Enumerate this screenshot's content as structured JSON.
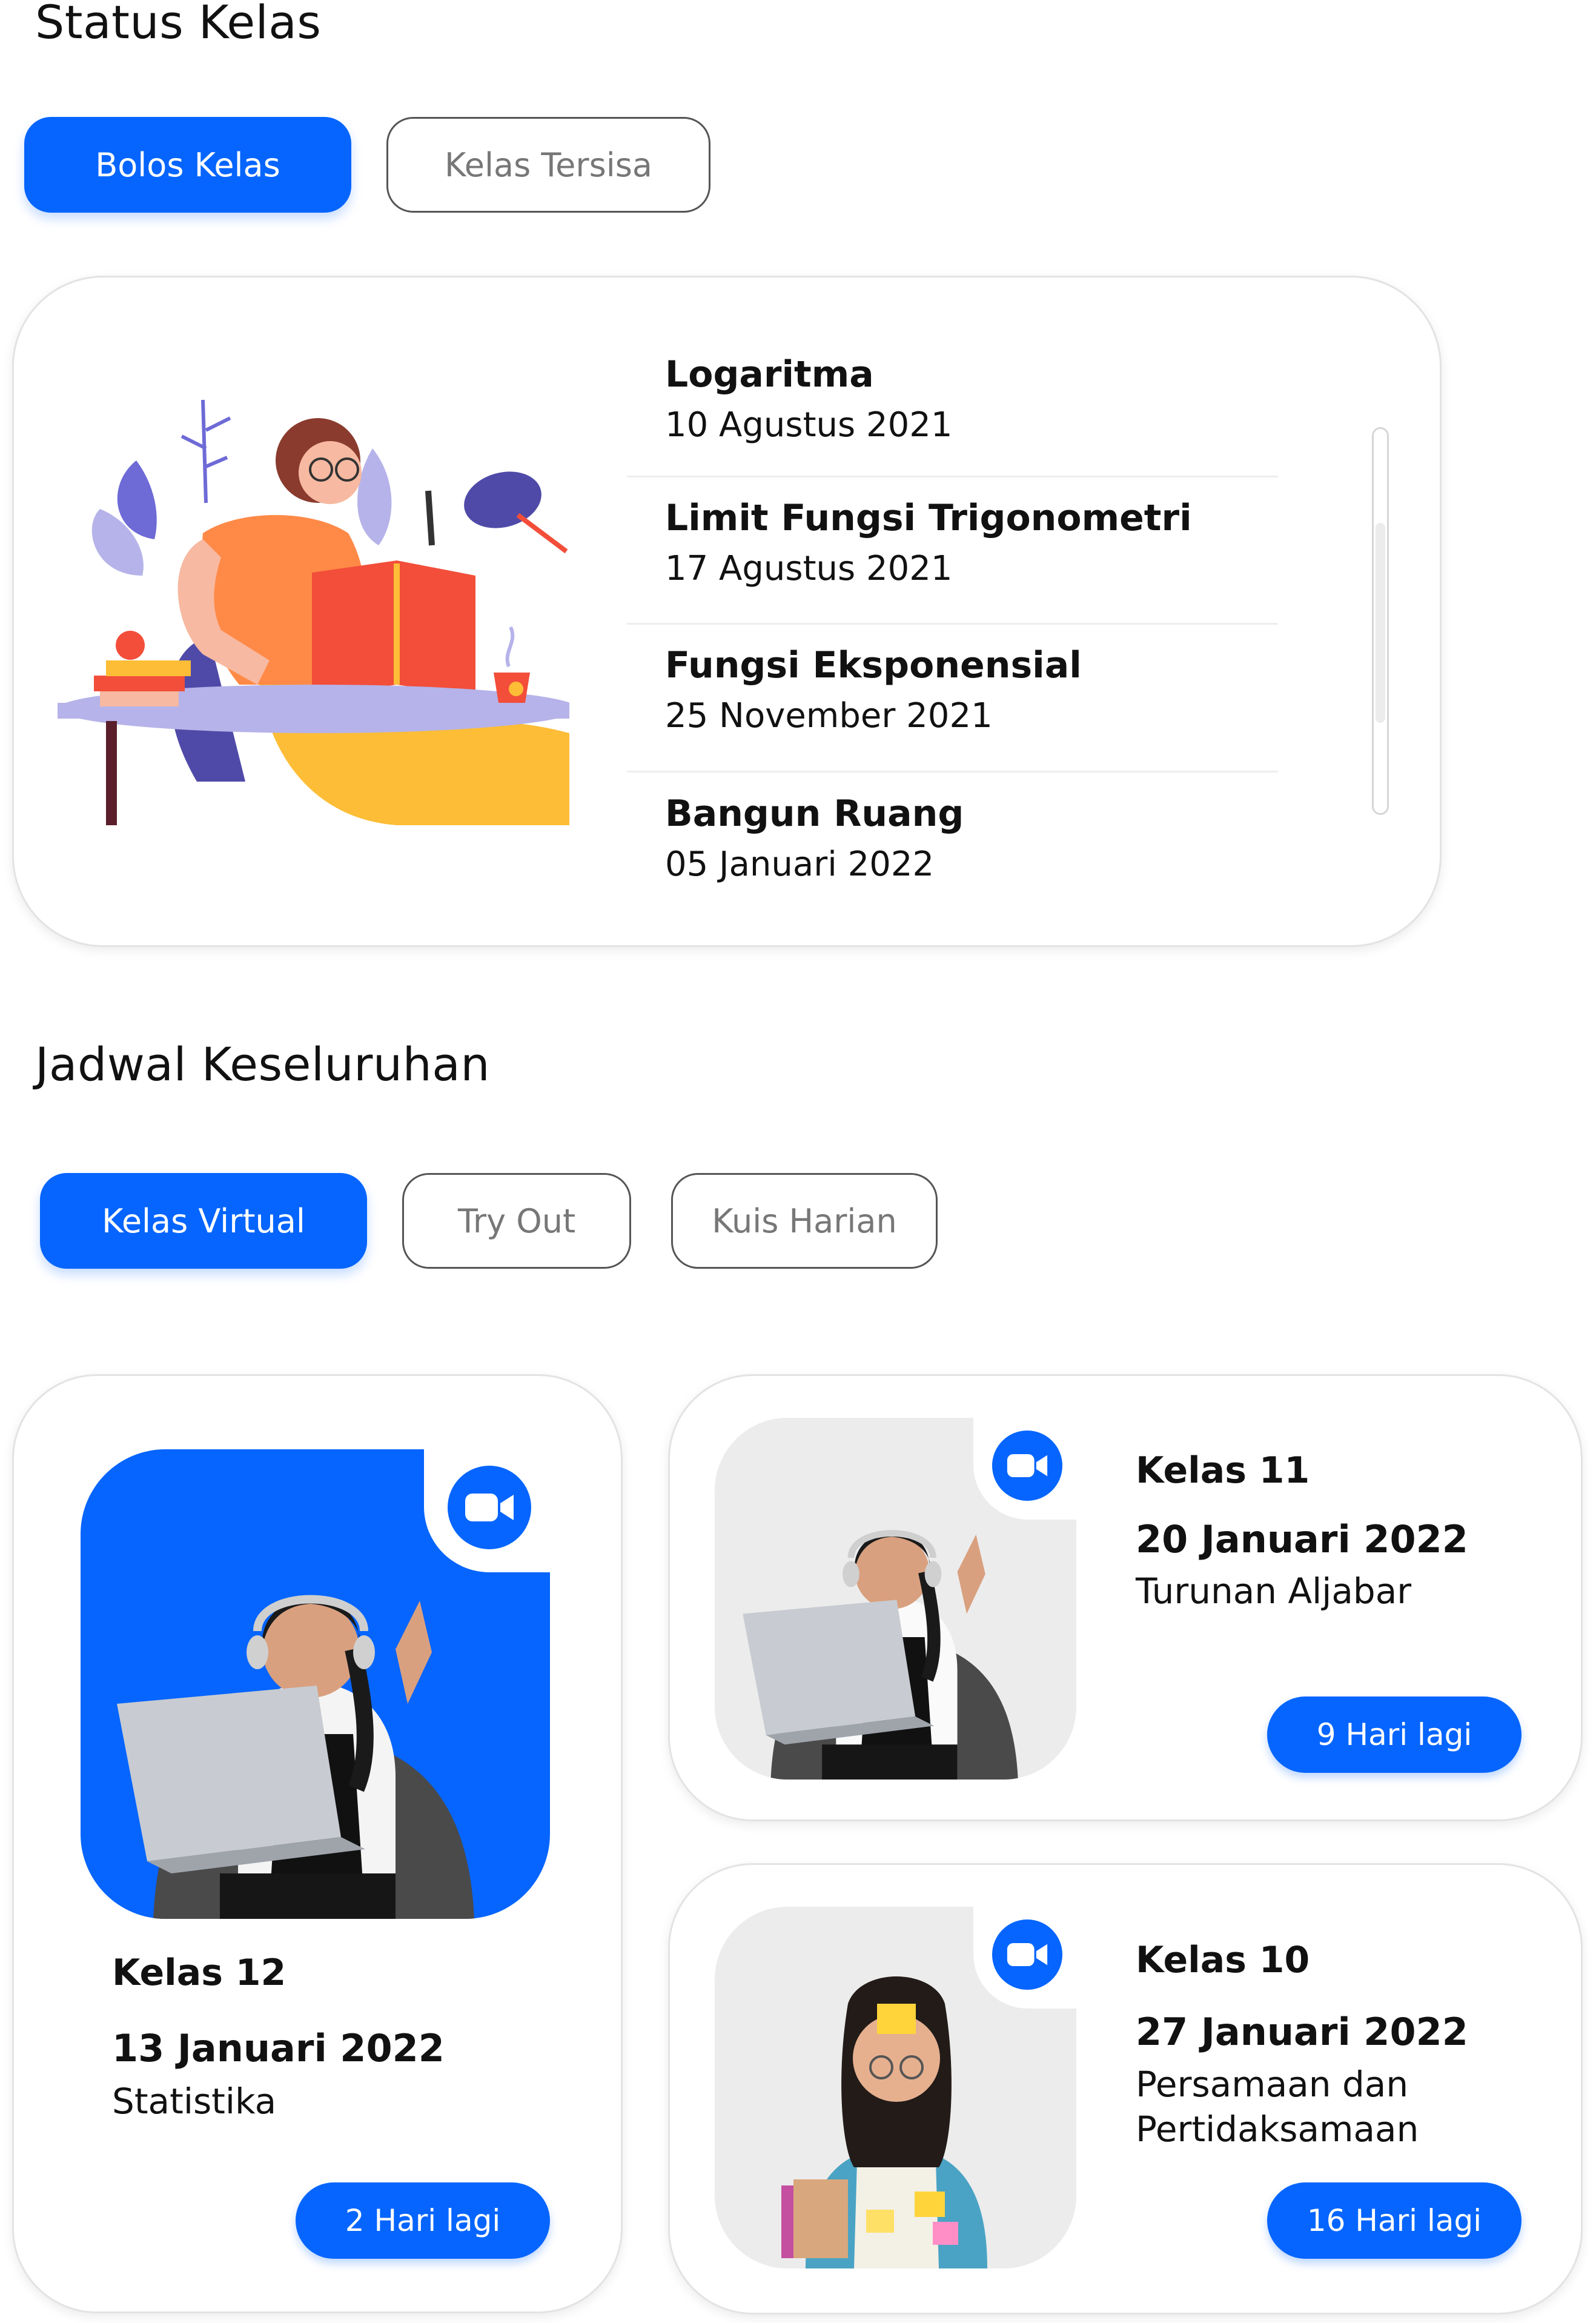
{
  "status_kelas": {
    "heading": "Status Kelas",
    "tabs": [
      {
        "label": "Bolos Kelas",
        "active": true
      },
      {
        "label": "Kelas Tersisa",
        "active": false
      }
    ],
    "items": [
      {
        "title": "Logaritma",
        "date": "10 Agustus 2021"
      },
      {
        "title": "Limit Fungsi Trigonometri",
        "date": "17 Agustus 2021"
      },
      {
        "title": "Fungsi Eksponensial",
        "date": "25 November 2021"
      },
      {
        "title": "Bangun Ruang",
        "date": "05 Januari 2022"
      }
    ]
  },
  "jadwal": {
    "heading": "Jadwal Keseluruhan",
    "tabs": [
      {
        "label": "Kelas Virtual",
        "active": true
      },
      {
        "label": "Try Out",
        "active": false
      },
      {
        "label": "Kuis Harian",
        "active": false
      }
    ],
    "cards": [
      {
        "kelas": "Kelas 12",
        "date": "13 Januari 2022",
        "topic": "Statistika",
        "countdown": "2 Hari lagi"
      },
      {
        "kelas": "Kelas 11",
        "date": "20 Januari 2022",
        "topic": "Turunan Aljabar",
        "countdown": "9 Hari lagi"
      },
      {
        "kelas": "Kelas 10",
        "date": "27 Januari 2022",
        "topic_line1": "Persamaan dan",
        "topic_line2": "Pertidaksamaan",
        "countdown": "16 Hari lagi"
      }
    ]
  },
  "colors": {
    "accent": "#0565fe",
    "text": "#111111",
    "muted": "#777777"
  },
  "icons": [
    "zoom-video-icon",
    "study-illustration",
    "student-photo"
  ]
}
